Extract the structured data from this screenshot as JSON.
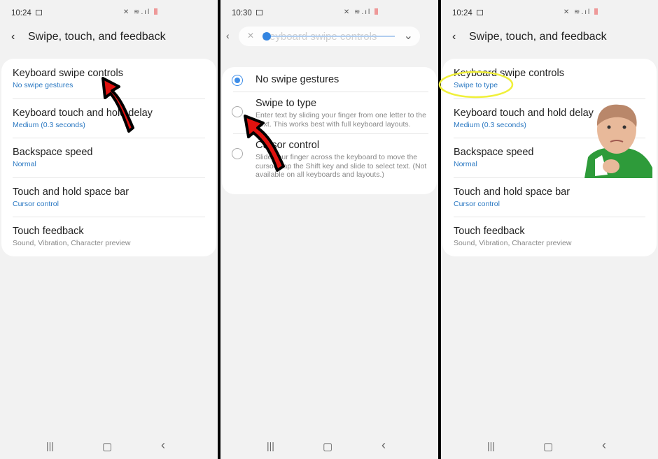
{
  "panels": [
    {
      "time": "10:24",
      "title": "Swipe, touch, and feedback",
      "items": [
        {
          "title": "Keyboard swipe controls",
          "sub": "No swipe gestures",
          "sub_gray": false
        },
        {
          "title": "Keyboard touch and hold delay",
          "sub": "Medium (0.3 seconds)",
          "sub_gray": false
        },
        {
          "title": "Backspace speed",
          "sub": "Normal",
          "sub_gray": false
        },
        {
          "title": "Touch and hold space bar",
          "sub": "Cursor control",
          "sub_gray": false
        },
        {
          "title": "Touch feedback",
          "sub": "Sound, Vibration, Character preview",
          "sub_gray": true
        }
      ]
    },
    {
      "time": "10:30",
      "title": "Keyboard swipe controls",
      "options": [
        {
          "title": "No swipe gestures",
          "desc": "",
          "selected": true
        },
        {
          "title": "Swipe to type",
          "desc": "Enter text by sliding your finger from one letter to the next. This works best with full keyboard layouts.",
          "selected": false
        },
        {
          "title": "Cursor control",
          "desc": "Slide your finger across the keyboard to move the cursor. Tap the Shift key and slide to select text. (Not available on all keyboards and layouts.)",
          "selected": false
        }
      ]
    },
    {
      "time": "10:24",
      "title": "Swipe, touch, and feedback",
      "items": [
        {
          "title": "Keyboard swipe controls",
          "sub": "Swipe to type",
          "sub_gray": false
        },
        {
          "title": "Keyboard touch and hold delay",
          "sub": "Medium (0.3 seconds)",
          "sub_gray": false
        },
        {
          "title": "Backspace speed",
          "sub": "Normal",
          "sub_gray": false
        },
        {
          "title": "Touch and hold space bar",
          "sub": "Cursor control",
          "sub_gray": false
        },
        {
          "title": "Touch feedback",
          "sub": "Sound, Vibration, Character preview",
          "sub_gray": true
        }
      ]
    }
  ],
  "nav": {
    "recents": "|||",
    "home": "▢",
    "back": "‹"
  },
  "icons": {
    "back": "‹",
    "mute": "🔇",
    "wifi": "≋",
    "signal": ".ıl",
    "expand": "⌄"
  },
  "colors": {
    "accent": "#2a78c2",
    "radio": "#3d8de8",
    "arrow": "#e0120f",
    "highlight": "#f0f03a"
  }
}
